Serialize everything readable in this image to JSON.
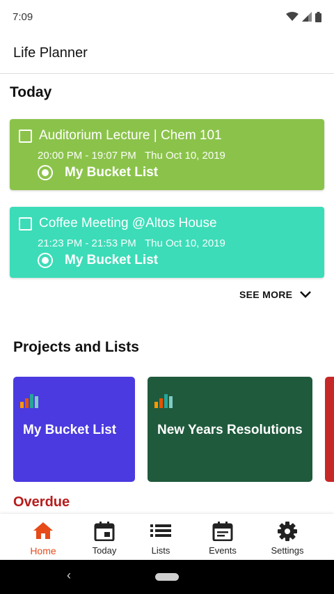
{
  "status_bar": {
    "time": "7:09",
    "icons": [
      "wifi-icon",
      "signal-icon",
      "battery-icon"
    ]
  },
  "app_bar": {
    "title": "Life Planner"
  },
  "today": {
    "heading": "Today",
    "events": [
      {
        "title": "Auditorium Lecture | Chem 101",
        "time": "20:00 PM - 19:07 PM   Thu Oct 10, 2019",
        "list": "My Bucket List",
        "color": "#8bc34a"
      },
      {
        "title": "Coffee Meeting @Altos House",
        "time": "21:23 PM - 21:53 PM   Thu Oct 10, 2019",
        "list": "My Bucket List",
        "color": "#3cdcb8"
      }
    ],
    "see_more": "SEE MORE"
  },
  "projects": {
    "heading": "Projects and Lists",
    "items": [
      {
        "name": "My Bucket List",
        "color": "#4a3ae0"
      },
      {
        "name": "New Years Resolutions",
        "color": "#1f5a3c"
      },
      {
        "name": "",
        "color": "#c62828"
      }
    ]
  },
  "overdue": {
    "heading": "Overdue"
  },
  "bottom_nav": {
    "items": [
      {
        "label": "Home",
        "icon": "home-icon",
        "active": true
      },
      {
        "label": "Today",
        "icon": "calendar-today-icon",
        "active": false
      },
      {
        "label": "Lists",
        "icon": "list-icon",
        "active": false
      },
      {
        "label": "Events",
        "icon": "events-icon",
        "active": false
      },
      {
        "label": "Settings",
        "icon": "gear-icon",
        "active": false
      }
    ],
    "active_color": "#e64a19"
  },
  "system_nav": {
    "back_glyph": "‹"
  }
}
